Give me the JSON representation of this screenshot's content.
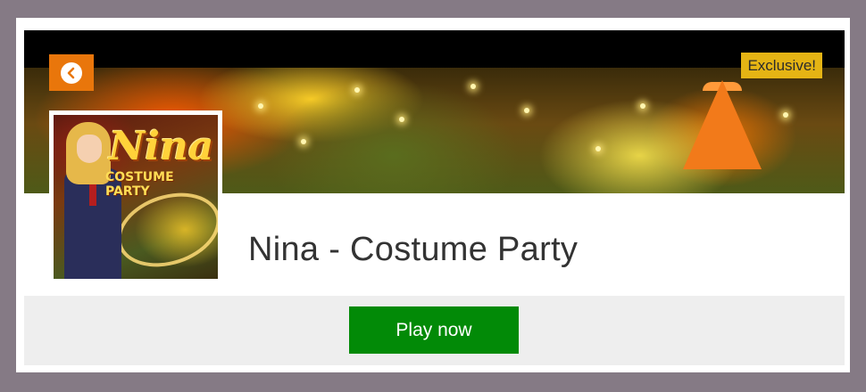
{
  "header": {
    "back_icon": "chevron-left-icon",
    "badge_label": "Exclusive!",
    "colors": {
      "back_button": "#e9760b",
      "badge": "#e5b414"
    }
  },
  "game": {
    "title": "Nina - Costume Party",
    "thumbnail": {
      "title_text": "Nina",
      "subtitle_text": "COSTUME PARTY"
    }
  },
  "actions": {
    "play_label": "Play now",
    "play_color": "#028a07"
  },
  "page": {
    "background": "#857a85"
  }
}
